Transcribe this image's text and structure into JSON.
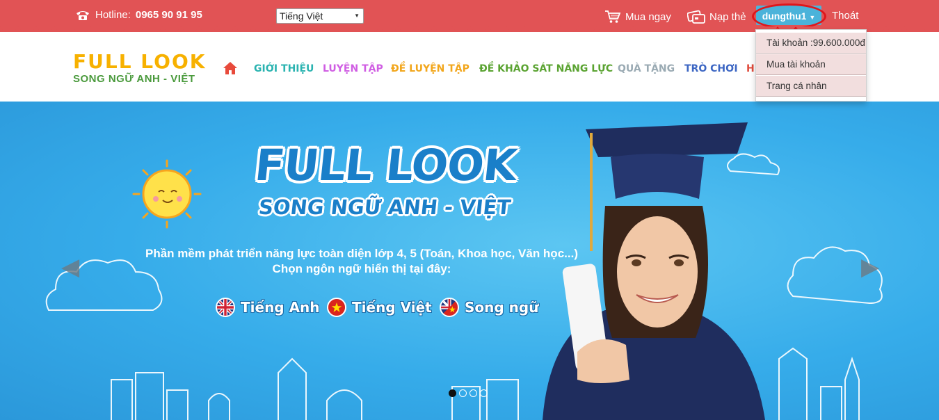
{
  "topbar": {
    "hotline_label": "Hotline:",
    "hotline_number": "0965 90 91 95",
    "language_selected": "Tiếng Việt",
    "buy_now": "Mua ngay",
    "top_up": "Nạp thẻ",
    "username": "dungthu1",
    "logout": "Thoát"
  },
  "user_menu": {
    "items": [
      "Tài khoản :99.600.000đ",
      "Mua tài khoản",
      "Trang cá nhân"
    ]
  },
  "logo": {
    "top": "FULL LOOK",
    "bottom": "SONG NGỮ ANH - VIỆT"
  },
  "nav": {
    "items": [
      {
        "label": "GIỚI THIỆU",
        "color": "#2ab3b0"
      },
      {
        "label": "LUYỆN TẬP",
        "color": "#d05ee3"
      },
      {
        "label": "ĐỀ LUYỆN TẬP",
        "color": "#f2a61b"
      },
      {
        "label": "ĐỀ KHẢO SÁT NĂNG LỰC",
        "color": "#5aa331"
      },
      {
        "label": "QUÀ TẶNG",
        "color": "#9aaab3"
      },
      {
        "label": "TRÒ CHƠI",
        "color": "#3c66c3"
      },
      {
        "label": "HƯ",
        "color": "#e04b3c"
      }
    ],
    "home_icon": "home-icon"
  },
  "hero": {
    "title": "FULL LOOK",
    "subtitle": "SONG NGỮ ANH - VIỆT",
    "desc_line1": "Phần mềm phát triển năng lực toàn diện lớp 4, 5 (Toán, Khoa học, Văn học...)",
    "desc_line2": "Chọn ngôn ngữ hiển thị tại đây:",
    "languages": [
      "Tiếng Anh",
      "Tiếng Việt",
      "Song ngữ"
    ],
    "slide_count": 4,
    "active_slide": 1
  },
  "colors": {
    "topbar": "#e15355",
    "hero": "#36acea",
    "user_button": "#4bb3da",
    "highlight_ring": "#e0161b"
  }
}
